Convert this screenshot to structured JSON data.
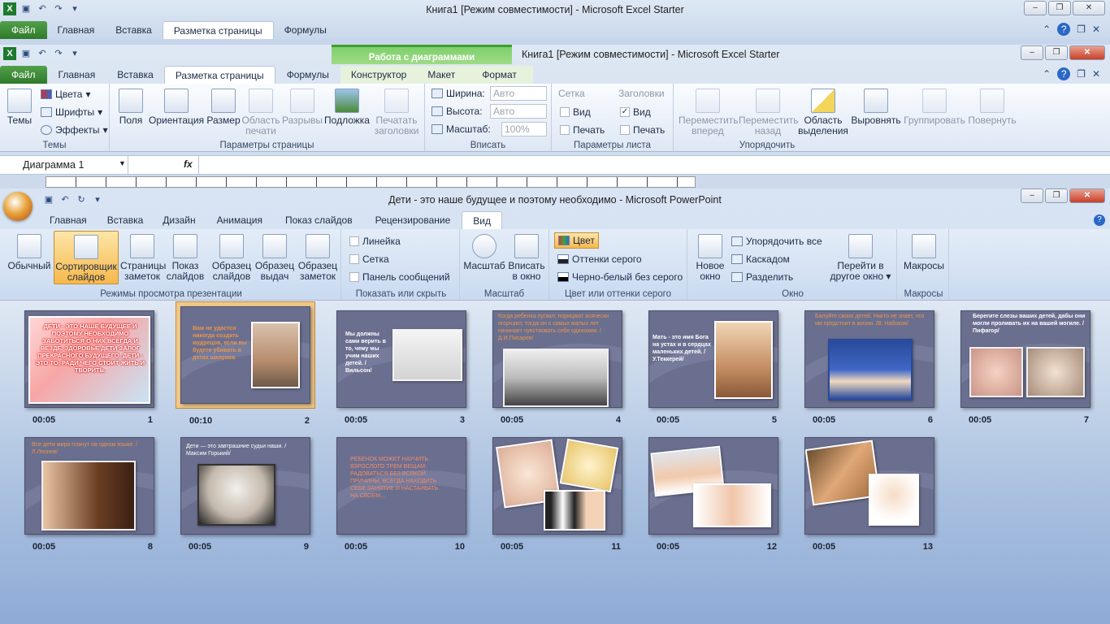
{
  "excel1": {
    "title": "Книга1  [Режим совместимости]  -  Microsoft Excel Starter",
    "tabs": [
      "Файл",
      "Главная",
      "Вставка",
      "Разметка страницы",
      "Формулы"
    ]
  },
  "excel2": {
    "title": "Книга1  [Режим совместимости]  -  Microsoft Excel Starter",
    "context_group": "Работа с диаграммами",
    "tabs": [
      "Файл",
      "Главная",
      "Вставка",
      "Разметка страницы",
      "Формулы",
      "Конструктор",
      "Макет",
      "Формат"
    ],
    "ribbon": {
      "temy": {
        "btn": "Темы",
        "colors": "Цвета",
        "fonts": "Шрифты",
        "effects": "Эффекты",
        "label": "Темы"
      },
      "page": {
        "pole": "Поля",
        "orient": "Ориентация",
        "razmer": "Размер",
        "oblast1": "Область",
        "oblast2": "печати",
        "razryvy": "Разрывы",
        "podlozhka": "Подложка",
        "pech1": "Печатать",
        "pech2": "заголовки",
        "label": "Параметры страницы"
      },
      "vpisat": {
        "width_l": "Ширина:",
        "width_v": "Авто",
        "height_l": "Высота:",
        "height_v": "Авто",
        "scale_l": "Масштаб:",
        "scale_v": "100%",
        "label": "Вписать"
      },
      "sheet": {
        "grid": "Сетка",
        "headers": "Заголовки",
        "view1": "Вид",
        "print1": "Печать",
        "view2": "Вид",
        "print2": "Печать",
        "label": "Параметры листа"
      },
      "order": {
        "fwd1": "Переместить",
        "fwd2": "вперед",
        "back1": "Переместить",
        "back2": "назад",
        "area1": "Область",
        "area2": "выделения",
        "align": "Выровнять",
        "group": "Группировать",
        "rotate": "Повернуть",
        "label": "Упорядочить"
      }
    },
    "namebox": "Диаграмма 1",
    "fx": "fx"
  },
  "ppt": {
    "title": "Дети - это наше будущее и поэтому необходимо  -  Microsoft PowerPoint",
    "tabs": [
      "Главная",
      "Вставка",
      "Дизайн",
      "Анимация",
      "Показ слайдов",
      "Рецензирование",
      "Вид"
    ],
    "ribbon": {
      "views": {
        "normal": "Обычный",
        "sorter1": "Сортировщик",
        "sorter2": "слайдов",
        "notes1": "Страницы",
        "notes2": "заметок",
        "show1": "Показ",
        "show2": "слайдов",
        "sm1": "Образец",
        "sm2": "слайдов",
        "hm1": "Образец",
        "hm2": "выдач",
        "nm1": "Образец",
        "nm2": "заметок",
        "label": "Режимы просмотра презентации"
      },
      "showhide": {
        "ruler": "Линейка",
        "grid": "Сетка",
        "msg": "Панель сообщений",
        "label": "Показать или скрыть"
      },
      "zoom": {
        "zoom": "Масштаб",
        "fit1": "Вписать",
        "fit2": "в окно",
        "label": "Масштаб"
      },
      "color": {
        "color": "Цвет",
        "gray": "Оттенки серого",
        "bw": "Черно-белый без серого",
        "label": "Цвет или оттенки серого"
      },
      "window": {
        "new1": "Новое",
        "new2": "окно",
        "arrange": "Упорядочить все",
        "cascade": "Каскадом",
        "split": "Разделить",
        "sw1": "Перейти в",
        "sw2": "другое окно",
        "label": "Окно"
      },
      "macros": {
        "btn": "Макросы",
        "label": "Макросы"
      }
    }
  },
  "slides": [
    {
      "n": "1",
      "t": "00:05",
      "text": "ДЕТИ - ЭТО НАШЕ БУДУЩЕЕ И ПОЭТОМУ НЕОБХОДИМО ЗАБОТИТЬСЯ О НИХ ВСЕГДА И ВЕЗДЕ. ЗДОРОВЬЕ ДЕТИ ЗАЛОГ ПРЕКРАСНОГО БУДУЩЕГО. ДЕТИ - ЭТО ТО, РАДИ ЧЕГО СТОИТ ЖИТЬ И ТВОРИТЬ."
    },
    {
      "n": "2",
      "t": "00:10",
      "text": "Вам не удастся никогда создать мудрецов, если вы будете убивать в детях шалунов"
    },
    {
      "n": "3",
      "t": "00:05",
      "text": "Мы должны сами верить в то, чему мы учим наших детей. /Вильсон/"
    },
    {
      "n": "4",
      "t": "00:05",
      "text": "Когда ребенка пугают, порицают всячески огорчают, тогда он с самых малых лет начинает чувствовать себя одиноким. /Д.И.Писарев/"
    },
    {
      "n": "5",
      "t": "00:05",
      "text": "Мать - это имя Бога на устах и в сердцах маленьких детей. /У.Теккерей/"
    },
    {
      "n": "6",
      "t": "00:05",
      "text": "Балуйте своих детей. Никто не знает, что им предстоит в жизни. /В. Набоков/"
    },
    {
      "n": "7",
      "t": "00:05",
      "text": "Берегите слезы ваших детей, дабы они могли проливать их на вашей могиле. /Пифагор/"
    },
    {
      "n": "8",
      "t": "00:05",
      "text": "Все дети мира плачут на одном языке. /Л.Леонов/"
    },
    {
      "n": "9",
      "t": "00:05",
      "text": "Дети — это завтрашние судьи наши. /Максим Горький/"
    },
    {
      "n": "10",
      "t": "00:05",
      "text": "РЕБЕНОК МОЖЕТ НАУЧИТЬ ВЗРОСЛОГО ТРЕМ ВЕЩАМ: РАДОВАТЬСЯ БЕЗ ВСЯКОЙ ПРИЧИНЫ, ВСЕГДА НАХОДИТЬ СЕБЕ ЗАНЯТИЕ И НАСТАИВАТЬ НА СВОЕМ..."
    },
    {
      "n": "11",
      "t": "00:05",
      "text": ""
    },
    {
      "n": "12",
      "t": "00:05",
      "text": ""
    },
    {
      "n": "13",
      "t": "00:05",
      "text": ""
    }
  ]
}
